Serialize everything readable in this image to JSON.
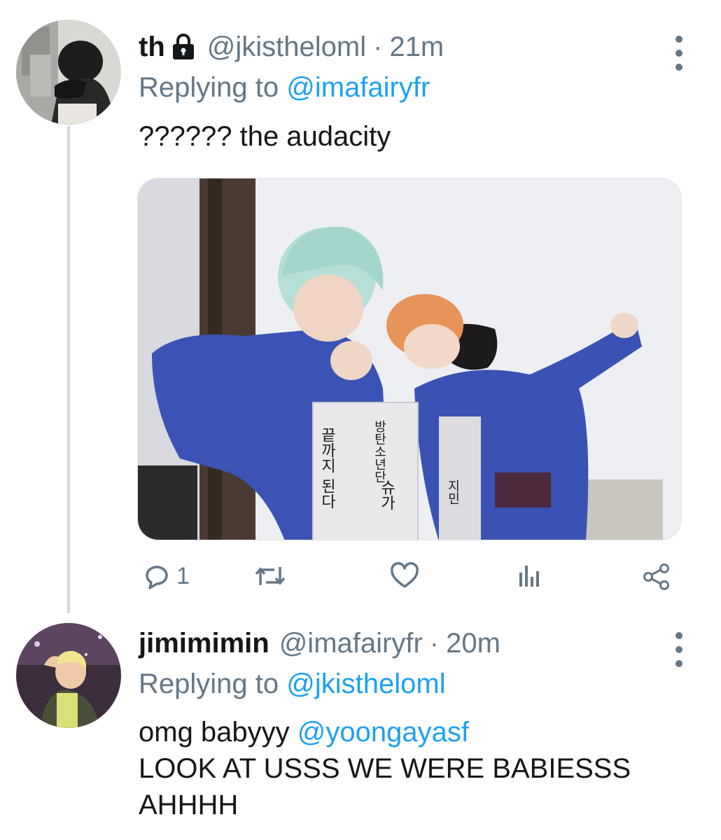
{
  "tweets": [
    {
      "display_name": "th",
      "handle": "@jkistheloml",
      "separator": "·",
      "time": "21m",
      "replying_prefix": "Replying to",
      "replying_to": "@imafairyfr",
      "text": "?????? the audacity",
      "media_texts": [
        "끝까지 된다",
        "방탄소년단",
        "슈가",
        "지민"
      ],
      "actions": {
        "reply_count": "1",
        "icons": [
          "reply-icon",
          "retweet-icon",
          "like-icon",
          "analytics-icon",
          "share-icon"
        ]
      },
      "locked": true
    },
    {
      "display_name": "jimimimin",
      "handle": "@imafairyfr",
      "separator": "·",
      "time": "20m",
      "replying_prefix": "Replying to",
      "replying_to": "@jkistheloml",
      "text_prefix": "omg babyyy",
      "text_mention": "@yoongayasf",
      "text_line2": "LOOK AT USSS WE WERE BABIESSS",
      "text_line3": "AHHHH"
    }
  ],
  "colors": {
    "link": "#1da1f2",
    "muted": "#657786",
    "text": "#14171a",
    "thread_line": "#cfd9de"
  }
}
